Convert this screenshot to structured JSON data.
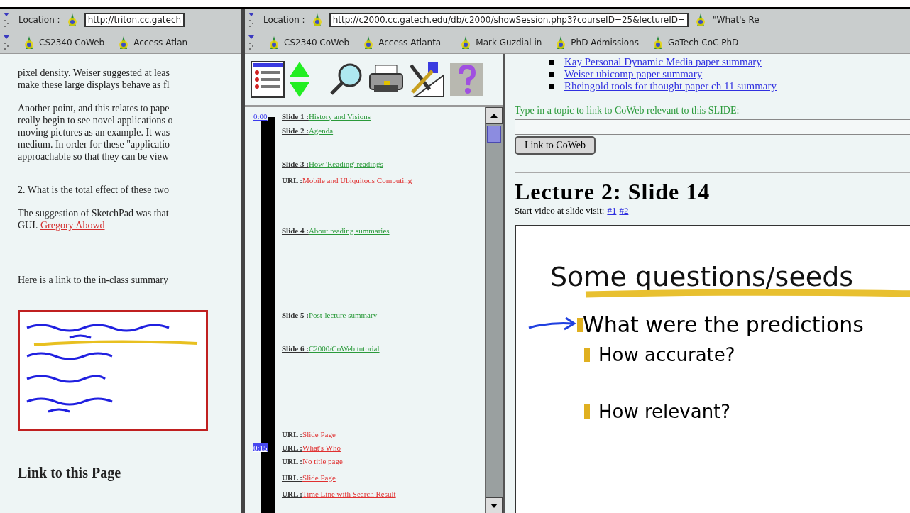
{
  "left_window": {
    "location": {
      "label": "Location :",
      "url": "http://triton.cc.gatech"
    },
    "bookmarks": [
      "CS2340 CoWeb",
      "Access Atlan"
    ],
    "paragraphs": [
      [
        "pixel density.  Weiser suggested at leas",
        "make these large displays behave as fl"
      ],
      [
        "Another point, and this relates to pape",
        "really begin to see novel applications o",
        "moving pictures as an example. It was",
        "medium. In order for these \"applicatio",
        "approachable so that they can be view"
      ],
      [
        "2.  What is the total effect of these two"
      ],
      [
        "The suggestion of SketchPad was that"
      ]
    ],
    "abowd_line": {
      "text": "GUI.",
      "link": "Gregory Abowd"
    },
    "summary_line": "Here is a link to the in-class summary",
    "heading": "Link to this Page"
  },
  "right_window": {
    "location": {
      "label": "Location :",
      "url": "http://c2000.cc.gatech.edu/db/c2000/showSession.php3?courseID=25&lectureID="
    },
    "whats_related": "\"What's Re",
    "bookmarks": [
      "CS2340 CoWeb",
      "Access Atlanta -",
      "Mark Guzdial in",
      "PhD Admissions",
      "GaTech CoC PhD"
    ],
    "session_items": [
      {
        "kind": "slide",
        "label": "Slide 1 :",
        "title": "History and Visions",
        "time": "0:00"
      },
      {
        "kind": "slide",
        "label": "Slide 2 :",
        "title": "Agenda"
      },
      {
        "kind": "slide",
        "label": "Slide 3 :",
        "title": "How 'Reading' readings"
      },
      {
        "kind": "url",
        "label": "URL :",
        "title": "Mobile and Ubiquitous Computing"
      },
      {
        "kind": "slide",
        "label": "Slide 4 :",
        "title": "About reading summaries"
      },
      {
        "kind": "slide",
        "label": "Slide 5 :",
        "title": "Post-lecture summary"
      },
      {
        "kind": "slide",
        "label": "Slide 6 :",
        "title": "C2000/CoWeb tutorial"
      },
      {
        "kind": "url",
        "label": "URL :",
        "title": "Slide Page"
      },
      {
        "kind": "url",
        "label": "URL :",
        "title": "What's Who",
        "time": "0:15"
      },
      {
        "kind": "url",
        "label": "URL :",
        "title": "No title page"
      },
      {
        "kind": "url",
        "label": "URL :",
        "title": "Slide Page"
      },
      {
        "kind": "url",
        "label": "URL :",
        "title": "Time Line with Search Result"
      }
    ],
    "reading_links": [
      "Kay Personal Dynamic Media paper summary",
      "Weiser ubicomp paper summary",
      "Rheingold tools for thought paper ch 11 summary"
    ],
    "topic_prompt": "Type in a topic to link to CoWeb relevant to this SLIDE:",
    "link_button": "Link to CoWeb",
    "lecture_title": "Lecture 2: Slide 14",
    "video_prompt": "Start video at slide visit:",
    "video_links": [
      "#1",
      "#2"
    ],
    "slide": {
      "title": "Some questions/seeds",
      "bullets": [
        {
          "text": "What were the predictions",
          "children": [
            "How accurate?",
            "How relevant?"
          ]
        }
      ]
    }
  }
}
